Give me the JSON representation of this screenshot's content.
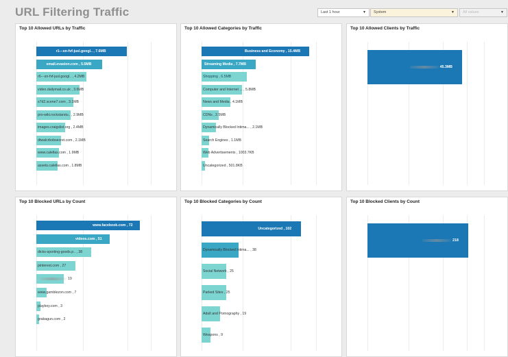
{
  "title": "URL Filtering Traffic",
  "filters": {
    "time": "Last 1 hour",
    "scope": "System",
    "extra": "All values"
  },
  "colors": {
    "top_bar": "#1b78b5",
    "second_bar": "#3aa8c4",
    "other_bars": "#7dd5d2"
  },
  "panels": [
    {
      "id": "allowed-urls",
      "title": "Top 10 Allowed URLs by Traffic",
      "items": [
        {
          "label": "r1---sn-fvf-jusl.googl..",
          "value": "7.6MB",
          "amount": 7.6
        },
        {
          "label": "email.evasion.com",
          "value": "5.5MB",
          "amount": 5.5
        },
        {
          "label": "r6---sn-fvf-jusl.googl..",
          "value": "4.2MB",
          "amount": 4.2
        },
        {
          "label": "video.dailymail.co.uk",
          "value": "3.6MB",
          "amount": 3.6
        },
        {
          "label": "s7d2.scene7.com",
          "value": "3.1MB",
          "amount": 3.1
        },
        {
          "label": "pro-wiki.rockstarstu..",
          "value": "2.9MB",
          "amount": 2.9
        },
        {
          "label": "images.craigslist.org",
          "value": "2.4MB",
          "amount": 2.4
        },
        {
          "label": "dtwalcrbobsecret.com",
          "value": "2.1MB",
          "amount": 2.1
        },
        {
          "label": "www.calellas.com",
          "value": "1.9MB",
          "amount": 1.9
        },
        {
          "label": "assets.calellas.com",
          "value": "1.8MB",
          "amount": 1.8
        }
      ]
    },
    {
      "id": "allowed-cats",
      "title": "Top 10 Allowed Categories by Traffic",
      "items": [
        {
          "label": "Business and Economy",
          "value": "15.4MB",
          "amount": 15.4
        },
        {
          "label": "Streaming Media",
          "value": "7.7MB",
          "amount": 7.7
        },
        {
          "label": "Shopping",
          "value": "6.5MB",
          "amount": 6.5
        },
        {
          "label": "Computer and Internet ...",
          "value": "5.8MB",
          "amount": 5.8
        },
        {
          "label": "News and Media",
          "value": "4.1MB",
          "amount": 4.1
        },
        {
          "label": "CDNs",
          "value": "2.5MB",
          "amount": 2.5
        },
        {
          "label": "Dynamically Blocked Intima...",
          "value": "2.1MB",
          "amount": 2.1
        },
        {
          "label": "Search Engines",
          "value": "1.1MB",
          "amount": 1.1
        },
        {
          "label": "Web Advertisements",
          "value": "1003.7KB",
          "amount": 0.98
        },
        {
          "label": "Uncategorized",
          "value": "501.8KB",
          "amount": 0.49
        }
      ]
    },
    {
      "id": "allowed-clients",
      "title": "Top 10 Allowed Clients by Traffic",
      "items": [
        {
          "label": "",
          "value": "45.3MB",
          "amount": 45.3,
          "redacted": true
        }
      ]
    },
    {
      "id": "blocked-urls",
      "title": "Top 10 Blocked URLs by Count",
      "items": [
        {
          "label": "www.facebook.com",
          "value": "72",
          "amount": 72
        },
        {
          "label": "videos.com",
          "value": "51",
          "amount": 51
        },
        {
          "label": "dicks-sporting-goods.p..",
          "value": "38",
          "amount": 38
        },
        {
          "label": "pinterest.com",
          "value": "27",
          "amount": 27
        },
        {
          "label": "",
          "value": "19",
          "amount": 19,
          "redacted": true
        },
        {
          "label": "www.gamblezon.com",
          "value": "7",
          "amount": 7
        },
        {
          "label": "playboy.com",
          "value": "3",
          "amount": 3
        },
        {
          "label": "grabagun.com",
          "value": "2",
          "amount": 2
        }
      ]
    },
    {
      "id": "blocked-cats",
      "title": "Top 10 Blocked Categories by Count",
      "items": [
        {
          "label": "Uncategorized",
          "value": "102",
          "amount": 102
        },
        {
          "label": "Dynamically Blocked Intima...",
          "value": "38",
          "amount": 38
        },
        {
          "label": "Social Network",
          "value": "25",
          "amount": 25
        },
        {
          "label": "Parked Sites",
          "value": "25",
          "amount": 25
        },
        {
          "label": "Adult and Pornography",
          "value": "19",
          "amount": 19
        },
        {
          "label": "Weapons",
          "value": "9",
          "amount": 9
        }
      ]
    },
    {
      "id": "blocked-clients",
      "title": "Top 10 Blocked Clients by Count",
      "items": [
        {
          "label": "",
          "value": "218",
          "amount": 218,
          "redacted": true
        }
      ]
    }
  ]
}
